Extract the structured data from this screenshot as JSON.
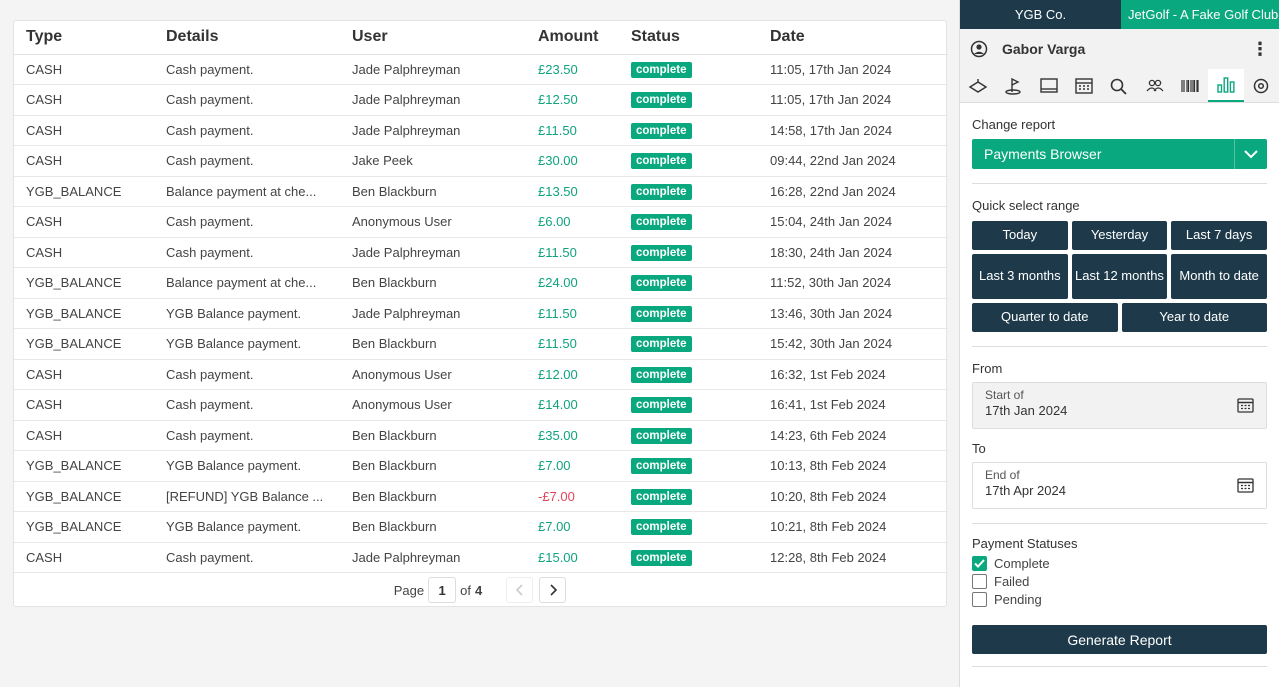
{
  "table": {
    "headers": [
      "Type",
      "Details",
      "User",
      "Amount",
      "Status",
      "Date"
    ],
    "rows": [
      {
        "type": "CASH",
        "details": "Cash payment.",
        "user": "Jade Palphreyman",
        "amount": "£23.50",
        "neg": false,
        "status": "complete",
        "date": "11:05, 17th Jan 2024"
      },
      {
        "type": "CASH",
        "details": "Cash payment.",
        "user": "Jade Palphreyman",
        "amount": "£12.50",
        "neg": false,
        "status": "complete",
        "date": "11:05, 17th Jan 2024"
      },
      {
        "type": "CASH",
        "details": "Cash payment.",
        "user": "Jade Palphreyman",
        "amount": "£11.50",
        "neg": false,
        "status": "complete",
        "date": "14:58, 17th Jan 2024"
      },
      {
        "type": "CASH",
        "details": "Cash payment.",
        "user": "Jake Peek",
        "amount": "£30.00",
        "neg": false,
        "status": "complete",
        "date": "09:44, 22nd Jan 2024"
      },
      {
        "type": "YGB_BALANCE",
        "details": "Balance payment at che...",
        "user": "Ben Blackburn",
        "amount": "£13.50",
        "neg": false,
        "status": "complete",
        "date": "16:28, 22nd Jan 2024"
      },
      {
        "type": "CASH",
        "details": "Cash payment.",
        "user": "Anonymous User",
        "amount": "£6.00",
        "neg": false,
        "status": "complete",
        "date": "15:04, 24th Jan 2024"
      },
      {
        "type": "CASH",
        "details": "Cash payment.",
        "user": "Jade Palphreyman",
        "amount": "£11.50",
        "neg": false,
        "status": "complete",
        "date": "18:30, 24th Jan 2024"
      },
      {
        "type": "YGB_BALANCE",
        "details": "Balance payment at che...",
        "user": "Ben Blackburn",
        "amount": "£24.00",
        "neg": false,
        "status": "complete",
        "date": "11:52, 30th Jan 2024"
      },
      {
        "type": "YGB_BALANCE",
        "details": "YGB Balance payment.",
        "user": "Jade Palphreyman",
        "amount": "£11.50",
        "neg": false,
        "status": "complete",
        "date": "13:46, 30th Jan 2024"
      },
      {
        "type": "YGB_BALANCE",
        "details": "YGB Balance payment.",
        "user": "Ben Blackburn",
        "amount": "£11.50",
        "neg": false,
        "status": "complete",
        "date": "15:42, 30th Jan 2024"
      },
      {
        "type": "CASH",
        "details": "Cash payment.",
        "user": "Anonymous User",
        "amount": "£12.00",
        "neg": false,
        "status": "complete",
        "date": "16:32, 1st Feb 2024"
      },
      {
        "type": "CASH",
        "details": "Cash payment.",
        "user": "Anonymous User",
        "amount": "£14.00",
        "neg": false,
        "status": "complete",
        "date": "16:41, 1st Feb 2024"
      },
      {
        "type": "CASH",
        "details": "Cash payment.",
        "user": "Ben Blackburn",
        "amount": "£35.00",
        "neg": false,
        "status": "complete",
        "date": "14:23, 6th Feb 2024"
      },
      {
        "type": "YGB_BALANCE",
        "details": "YGB Balance payment.",
        "user": "Ben Blackburn",
        "amount": "£7.00",
        "neg": false,
        "status": "complete",
        "date": "10:13, 8th Feb 2024"
      },
      {
        "type": "YGB_BALANCE",
        "details": "[REFUND] YGB Balance ...",
        "user": "Ben Blackburn",
        "amount": "-£7.00",
        "neg": true,
        "status": "complete",
        "date": "10:20, 8th Feb 2024"
      },
      {
        "type": "YGB_BALANCE",
        "details": "YGB Balance payment.",
        "user": "Ben Blackburn",
        "amount": "£7.00",
        "neg": false,
        "status": "complete",
        "date": "10:21, 8th Feb 2024"
      },
      {
        "type": "CASH",
        "details": "Cash payment.",
        "user": "Jade Palphreyman",
        "amount": "£15.00",
        "neg": false,
        "status": "complete",
        "date": "12:28, 8th Feb 2024"
      }
    ]
  },
  "pager": {
    "page_label": "Page",
    "current": "1",
    "of_label": "of",
    "total": "4"
  },
  "sidebar": {
    "tab_a": "YGB Co.",
    "tab_b": "JetGolf - A Fake Golf Club",
    "user_name": "Gabor Varga",
    "icons": [
      "tee-icon",
      "golf-flag-icon",
      "screen-icon",
      "calendar-icon",
      "search-icon",
      "users-icon",
      "barcode-icon",
      "chart-icon",
      "settings-icon"
    ],
    "active_icon": "chart-icon",
    "change_report_label": "Change report",
    "report_selected": "Payments Browser",
    "quick_select_label": "Quick select range",
    "quick": {
      "today": "Today",
      "yesterday": "Yesterday",
      "last7": "Last 7 days",
      "last3m": "Last 3 months",
      "last12m": "Last 12 months",
      "mtd": "Month to date",
      "qtd": "Quarter to date",
      "ytd": "Year to date"
    },
    "from_label": "From",
    "from_caption": "Start of",
    "from_value": "17th Jan 2024",
    "to_label": "To",
    "to_caption": "End of",
    "to_value": "17th Apr 2024",
    "statuses_label": "Payment Statuses",
    "statuses": [
      {
        "label": "Complete",
        "checked": true
      },
      {
        "label": "Failed",
        "checked": false
      },
      {
        "label": "Pending",
        "checked": false
      }
    ],
    "generate_label": "Generate Report"
  },
  "colors": {
    "accent": "#0aa87e",
    "navy": "#1e3a4a",
    "negative": "#e0455c"
  }
}
